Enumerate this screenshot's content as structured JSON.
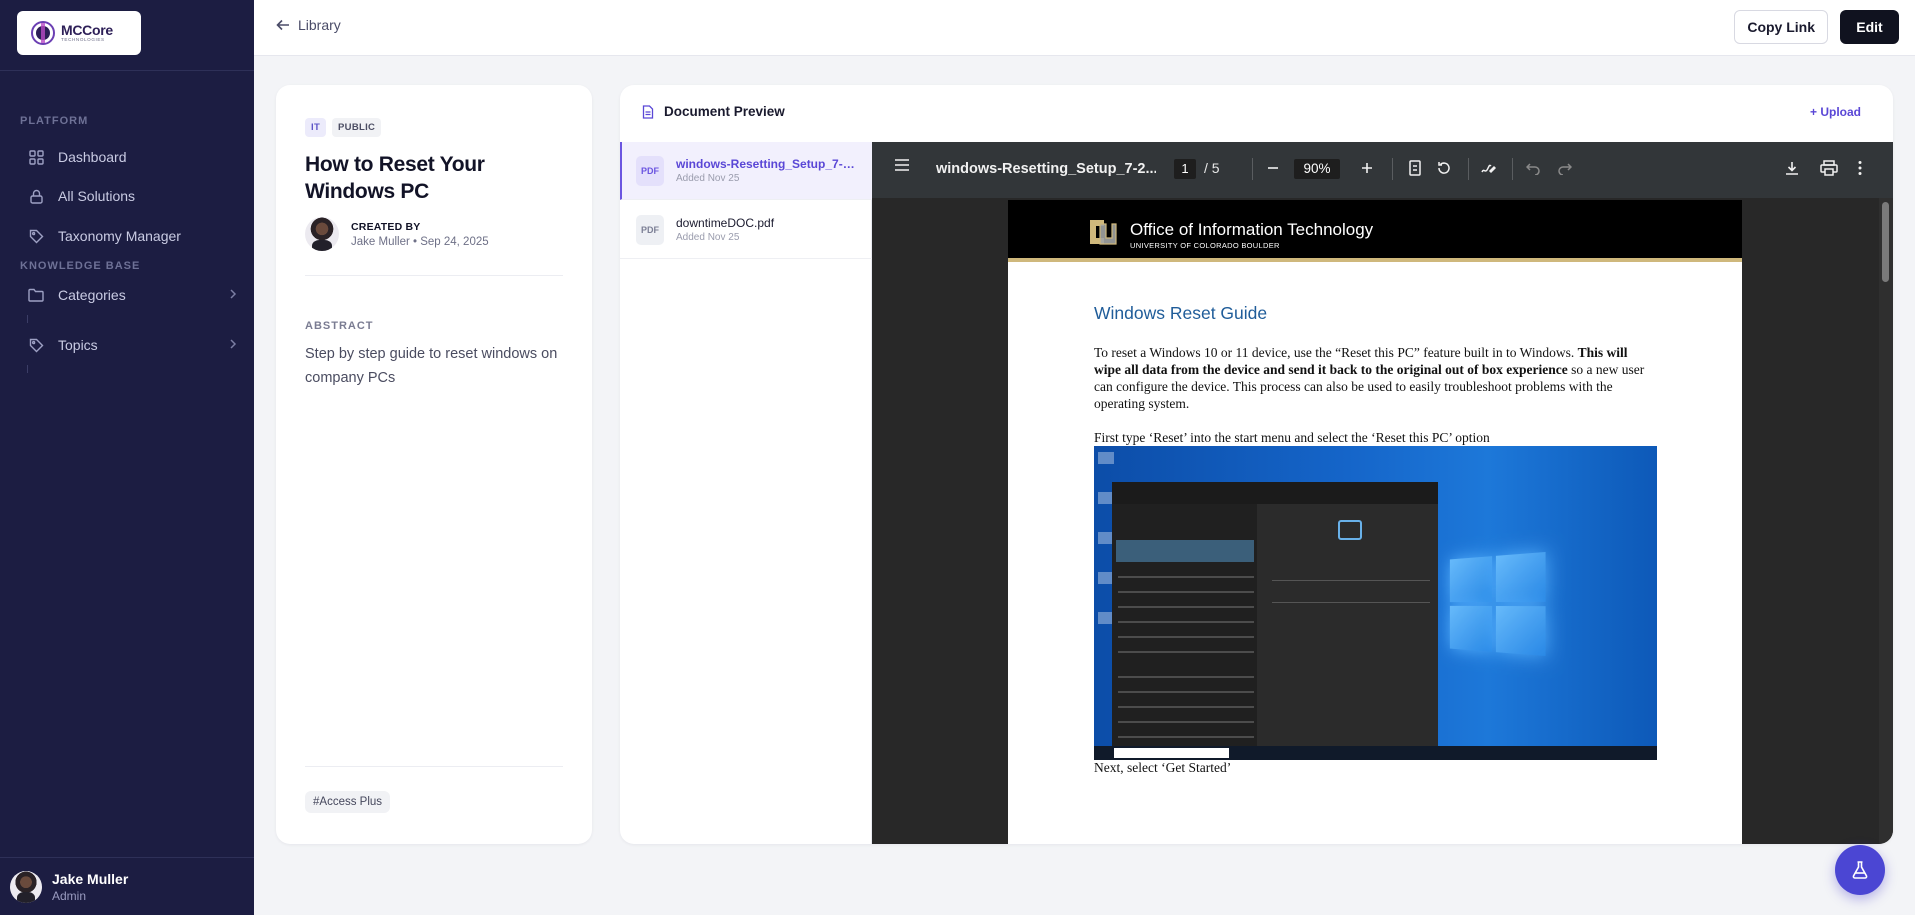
{
  "app": {
    "logo_text": "MCCore",
    "logo_sub": "TECHNOLOGIES"
  },
  "sidebar": {
    "section_platform": "PLATFORM",
    "section_kb": "KNOWLEDGE BASE",
    "items": [
      {
        "label": "Dashboard",
        "icon": "grid-icon"
      },
      {
        "label": "All Solutions",
        "icon": "lock-icon"
      },
      {
        "label": "Taxonomy Manager",
        "icon": "tag-icon"
      },
      {
        "label": "Categories",
        "icon": "folder-icon"
      },
      {
        "label": "Topics",
        "icon": "tag-icon"
      }
    ],
    "user": {
      "name": "Jake Muller",
      "role": "Admin"
    }
  },
  "topbar": {
    "back_label": "Library",
    "copy_link": "Copy Link",
    "edit": "Edit"
  },
  "doc": {
    "badges": [
      "IT",
      "PUBLIC"
    ],
    "title": "How to Reset Your Windows PC",
    "created_by_label": "CREATED BY",
    "author_meta": "Jake Muller • Sep 24, 2025",
    "abstract_label": "ABSTRACT",
    "abstract": "Step by step guide to reset windows on company PCs",
    "tag": "#Access Plus"
  },
  "preview": {
    "heading": "Document Preview",
    "upload": "+ Upload",
    "files": [
      {
        "type": "PDF",
        "name": "windows-Resetting_Setup_7-23....",
        "added": "Added Nov 25",
        "active": true
      },
      {
        "type": "PDF",
        "name": "downtimeDOC.pdf",
        "added": "Added Nov 25",
        "active": false
      }
    ]
  },
  "viewer": {
    "filename": "windows-Resetting_Setup_7-2...",
    "page_current": "1",
    "page_total": "/ 5",
    "zoom": "90%"
  },
  "pdf_page": {
    "header_title": "Office of Information Technology",
    "header_sub": "UNIVERSITY OF COLORADO BOULDER",
    "heading": "Windows Reset Guide",
    "p1_a": "To reset a Windows 10 or 11 device, use the “Reset this PC” feature built in to Windows.",
    "p1_bold": "This will wipe all data from the device and send it back to the original out of box experience",
    "p1_c": " so a new user can configure the device.  This process can also be used to easily troubleshoot problems with the operating system.",
    "p2": "First type ‘Reset’ into the start menu and select the ‘Reset this PC’ option",
    "p3": "Next, select ‘Get Started’"
  },
  "colors": {
    "sidebar_bg": "#1c1d42",
    "accent": "#5a47d6",
    "edit_button": "#10121f",
    "pdf_heading": "#1f5c99"
  }
}
